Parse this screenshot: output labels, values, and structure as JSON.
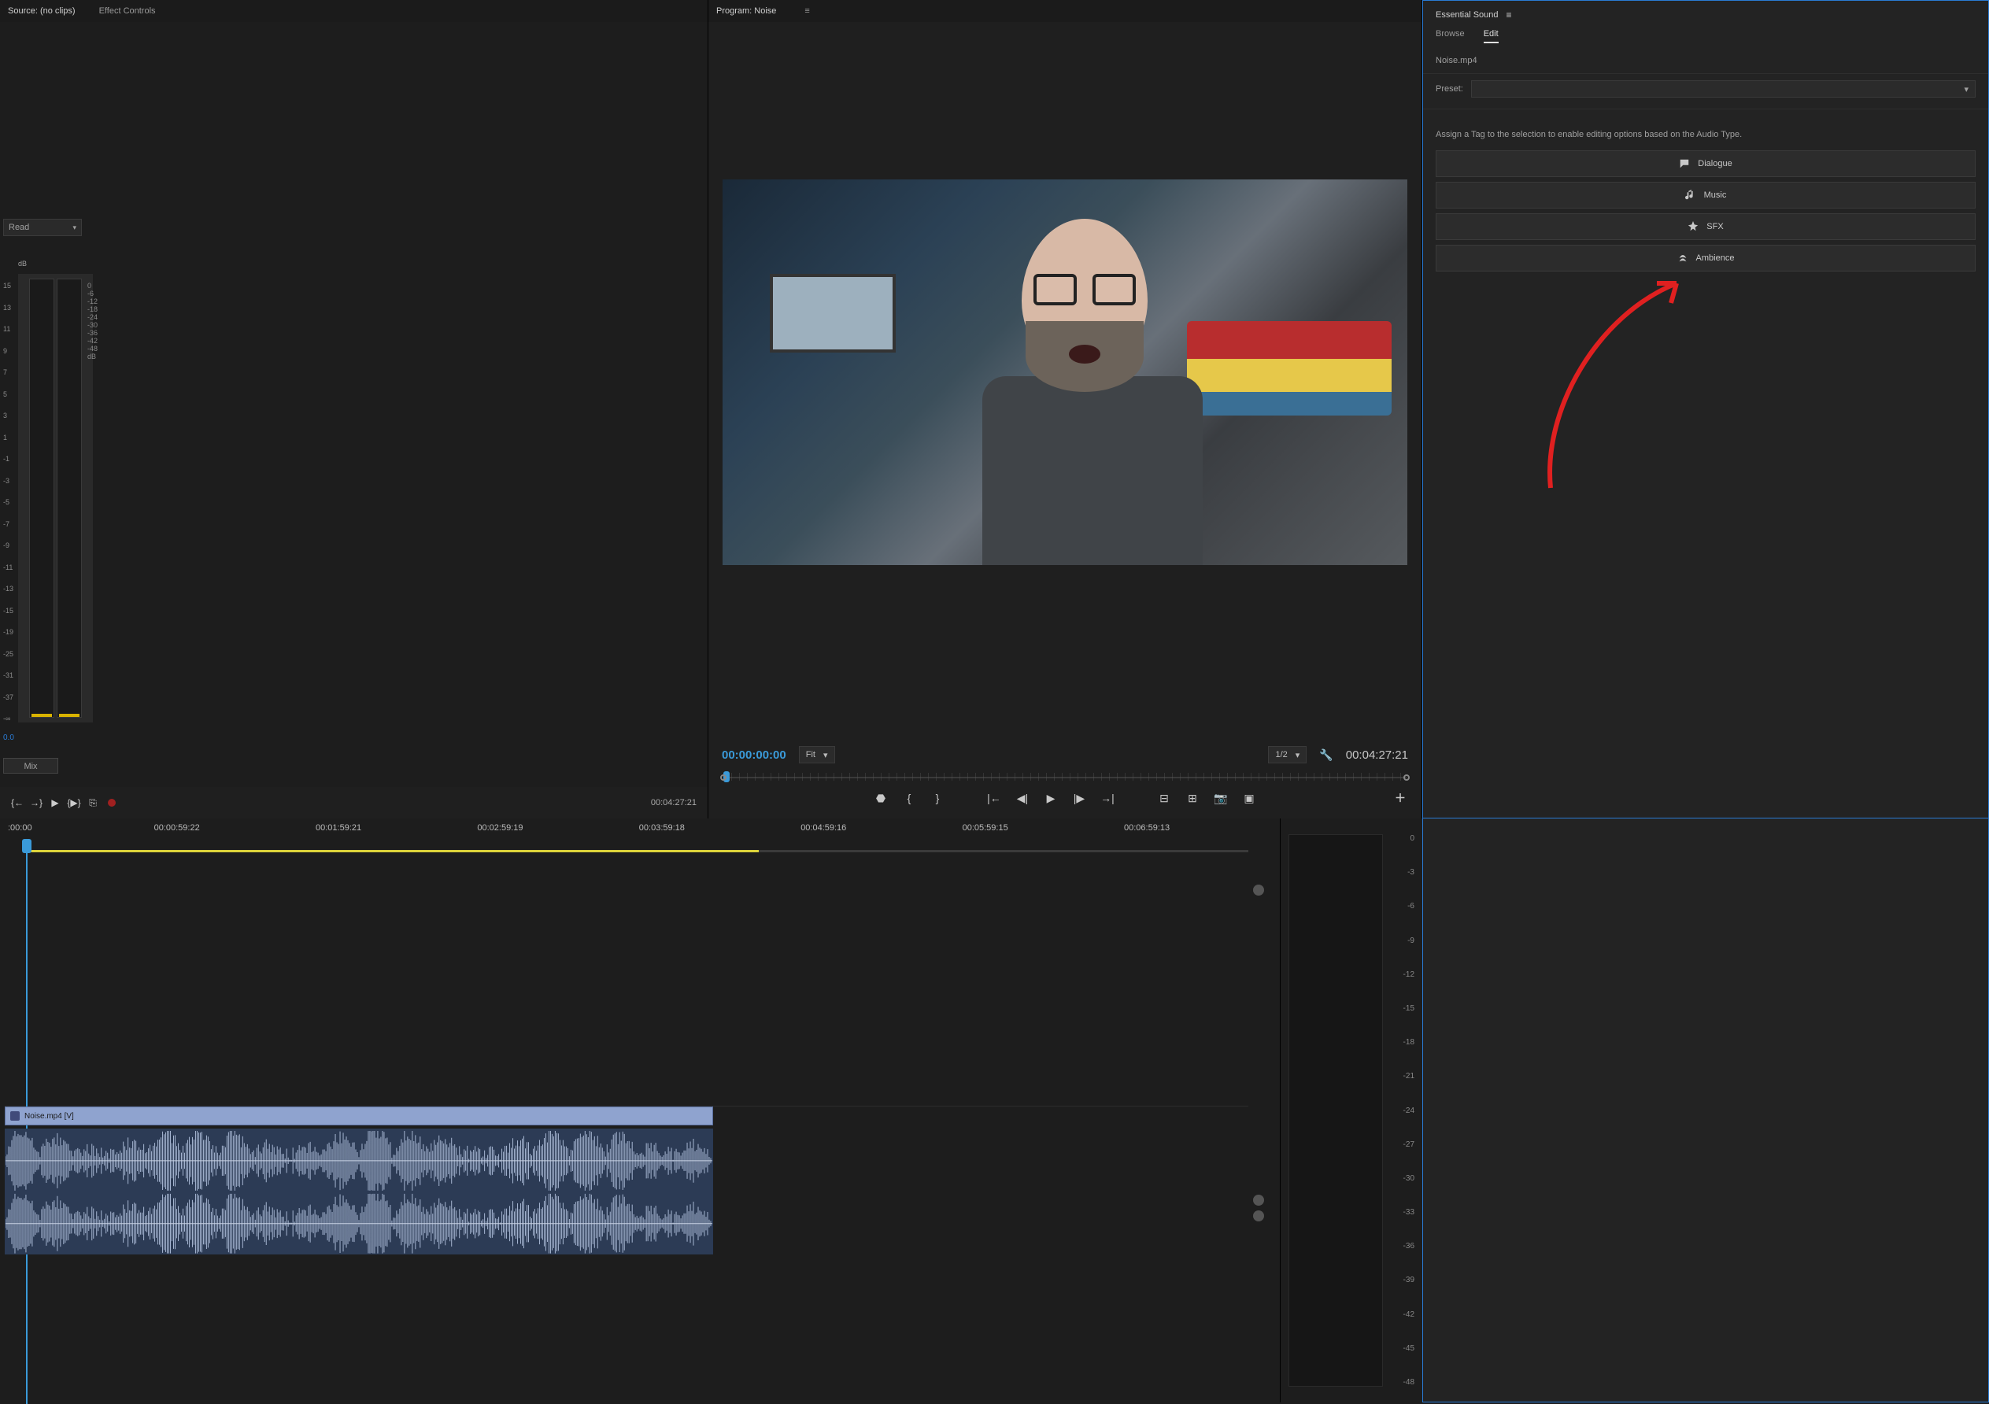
{
  "source": {
    "tabs": [
      "Source: (no clips)",
      "Effect Controls"
    ],
    "read_label": "Read",
    "meter_db_top": "dB",
    "meter_left_ticks": [
      "15",
      "13",
      "11",
      "9",
      "7",
      "5",
      "3",
      "1",
      "-1",
      "-3",
      "-5",
      "-7",
      "-9",
      "-11",
      "-13",
      "-15",
      "-19",
      "-25",
      "-31",
      "-37",
      "-∞"
    ],
    "meter_right_ticks": [
      "0",
      "",
      "-6",
      "",
      "-12",
      "",
      "-18",
      "",
      "-24",
      "",
      "-30",
      "",
      "-36",
      "",
      "-42",
      "",
      "-48",
      "",
      "",
      "",
      "dB"
    ],
    "zero": "0.0",
    "mix": "Mix",
    "end_tc": "00:04:27:21"
  },
  "program": {
    "tab": "Program: Noise",
    "tc_current": "00:00:00:00",
    "fit": "Fit",
    "half": "1/2",
    "tc_duration": "00:04:27:21"
  },
  "es": {
    "title": "Essential Sound",
    "tabs": {
      "browse": "Browse",
      "edit": "Edit"
    },
    "clip_name": "Noise.mp4",
    "preset_label": "Preset:",
    "hint": "Assign a Tag to the selection to enable editing options based on the Audio Type.",
    "types": {
      "dialogue": "Dialogue",
      "music": "Music",
      "sfx": "SFX",
      "ambience": "Ambience"
    }
  },
  "timeline": {
    "start_tc": ":00:00",
    "ticks": [
      {
        "label": "00:00:59:22",
        "pct": 12
      },
      {
        "label": "00:01:59:21",
        "pct": 25
      },
      {
        "label": "00:02:59:19",
        "pct": 38
      },
      {
        "label": "00:03:59:18",
        "pct": 51
      },
      {
        "label": "00:04:59:16",
        "pct": 64
      },
      {
        "label": "00:05:59:15",
        "pct": 77
      },
      {
        "label": "00:06:59:13",
        "pct": 90
      }
    ],
    "played_pct": 59,
    "vclip_label": "Noise.mp4 [V]"
  },
  "right_meter_ticks": [
    "0",
    "-3",
    "-6",
    "-9",
    "-12",
    "-15",
    "-18",
    "-21",
    "-24",
    "-27",
    "-30",
    "-33",
    "-36",
    "-39",
    "-42",
    "-45",
    "-48"
  ]
}
